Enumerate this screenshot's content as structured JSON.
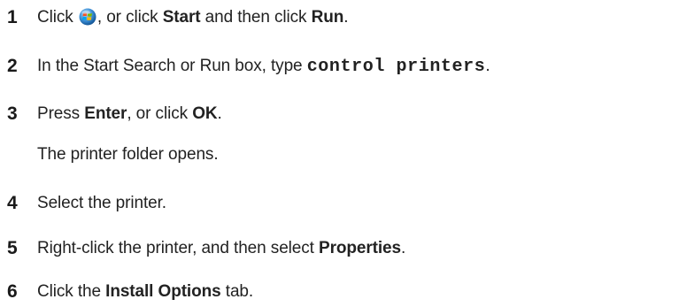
{
  "steps": [
    {
      "number": "1",
      "parts": {
        "t1": "Click ",
        "icon": "windows-start-orb-icon",
        "t2": ", or click ",
        "b1": "Start",
        "t3": " and then click ",
        "b2": "Run",
        "t4": "."
      }
    },
    {
      "number": "2",
      "parts": {
        "t1": "In the Start Search or Run box, type ",
        "code": "control printers",
        "t2": "."
      }
    },
    {
      "number": "3",
      "parts": {
        "t1": "Press ",
        "b1": "Enter",
        "t2": ", or click ",
        "b2": "OK",
        "t3": "."
      },
      "result": "The printer folder opens."
    },
    {
      "number": "4",
      "parts": {
        "t1": "Select the printer."
      }
    },
    {
      "number": "5",
      "parts": {
        "t1": "Right-click the printer, and then select ",
        "b1": "Properties",
        "t2": "."
      }
    },
    {
      "number": "6",
      "parts": {
        "t1": "Click the ",
        "b1": "Install Options",
        "t2": " tab."
      }
    }
  ]
}
